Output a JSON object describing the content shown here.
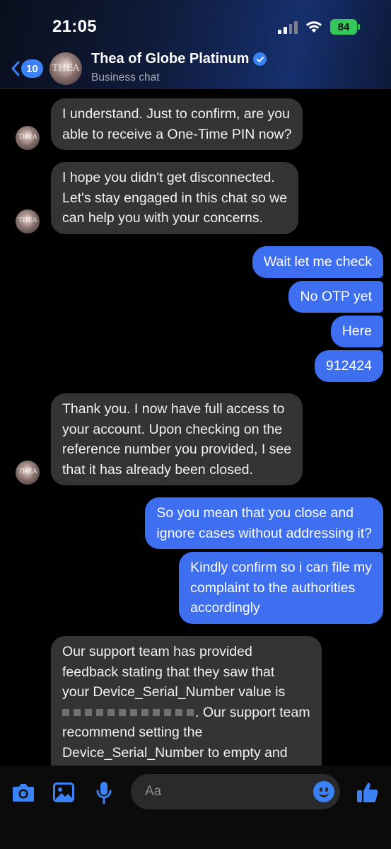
{
  "status_bar": {
    "time": "21:05",
    "battery": "84"
  },
  "header": {
    "back_count": "10",
    "avatar_watermark": "THEA",
    "title": "Thea of Globe Platinum",
    "subtitle": "Business chat"
  },
  "messages": [
    {
      "from": "agent",
      "lines": [
        "I understand. Just to confirm, are you",
        "able to receive a One-Time PIN now?"
      ]
    },
    {
      "from": "agent",
      "lines": [
        "I hope you didn't get disconnected.",
        "Let's stay engaged in this chat so we",
        "can help you with your concerns."
      ]
    },
    {
      "from": "user",
      "lines": [
        "Wait let me check"
      ]
    },
    {
      "from": "user",
      "lines": [
        "No OTP yet"
      ]
    },
    {
      "from": "user",
      "lines": [
        "Here"
      ]
    },
    {
      "from": "user",
      "lines": [
        "912424"
      ]
    },
    {
      "from": "agent",
      "lines": [
        "Thank you. I now have full access to",
        "your account. Upon checking on the",
        "reference number you provided, I see",
        "that it has already been closed."
      ]
    },
    {
      "from": "user",
      "lines": [
        "So you mean that you close and",
        "ignore cases without addressing it?"
      ]
    },
    {
      "from": "user",
      "lines": [
        "Kindly confirm so i can file my",
        "complaint to the authorities",
        "accordingly"
      ]
    },
    {
      "from": "agent",
      "lines": [
        "Our support team has provided",
        "feedback stating that they saw that",
        "your Device_Serial_Number value is",
        ". Our support team",
        "recommend setting the",
        "Device_Serial_Number to empty and"
      ]
    }
  ],
  "composer": {
    "placeholder": "Aa",
    "tools": [
      "camera-icon",
      "image-icon",
      "microphone-icon"
    ],
    "send_icon": "thumbs-up-icon"
  },
  "colors": {
    "outgoing": "#3d6ff0",
    "incoming": "#343434",
    "accent": "#3b82f6",
    "battery": "#34c759"
  }
}
